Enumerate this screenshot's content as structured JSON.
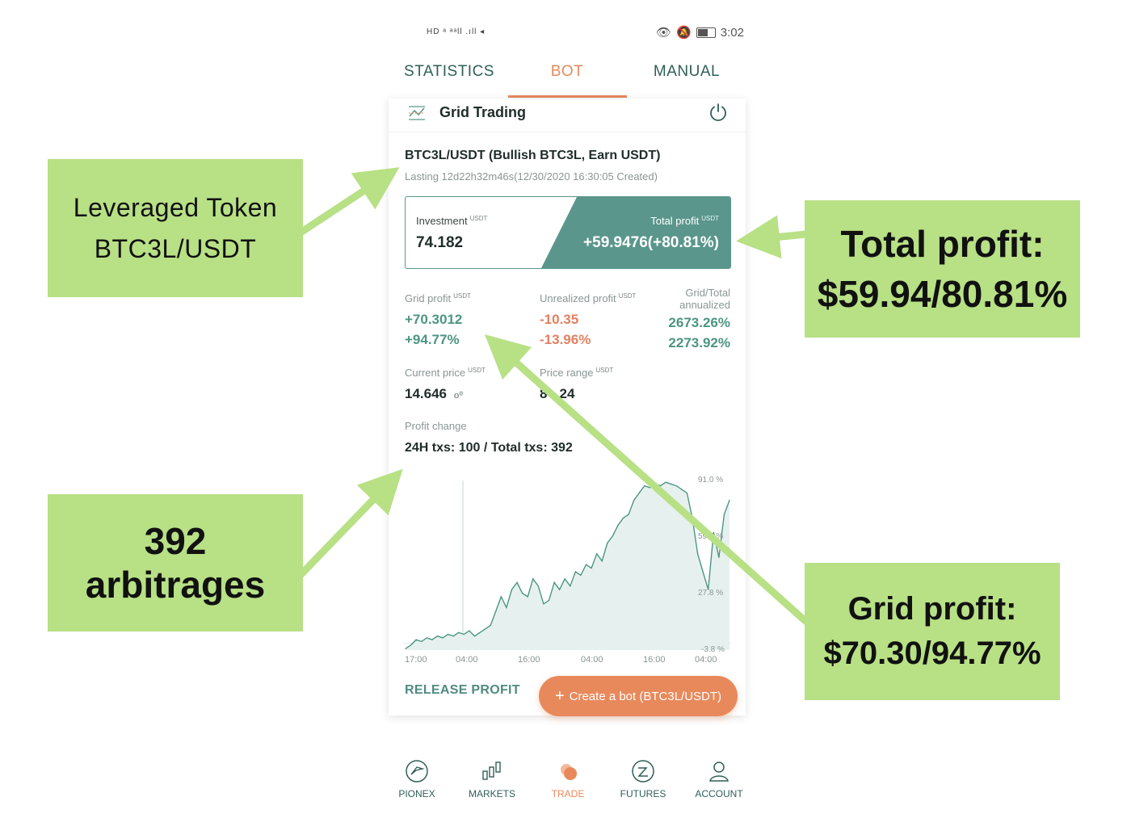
{
  "status_bar": {
    "left": "HD ᵃ ᵃᵃll .ıll ◂",
    "time": "3:02"
  },
  "tabs": [
    {
      "label": "STATISTICS"
    },
    {
      "label": "BOT"
    },
    {
      "label": "MANUAL"
    }
  ],
  "card": {
    "title": "Grid Trading",
    "pair": "BTC3L/USDT (Bullish BTC3L, Earn USDT)",
    "lasting": "Lasting 12d22h32m46s(12/30/2020 16:30:05 Created)",
    "investment_label": "Investment",
    "investment_value": "74.182",
    "unit": "USDT",
    "total_profit_label": "Total profit",
    "total_profit_value": "+59.9476(+80.81%)"
  },
  "stats": {
    "grid_profit_label": "Grid profit",
    "grid_profit_value": "+70.3012",
    "grid_profit_pct": "+94.77%",
    "unrealized_label": "Unrealized profit",
    "unrealized_value": "-10.35",
    "unrealized_pct": "-13.96%",
    "annualized_label_1": "Grid/Total",
    "annualized_label_2": "annualized",
    "annualized_grid": "2673.26%",
    "annualized_total": "2273.92%",
    "current_price_label": "Current price",
    "current_price_value": "14.646",
    "price_range_label": "Price range",
    "price_range_value": "8 - 24",
    "profit_change_label": "Profit change",
    "txs": "24H txs: 100 / Total txs: 392"
  },
  "chart_data": {
    "type": "line",
    "x_ticks": [
      "17:00",
      "04:00",
      "16:00",
      "04:00",
      "16:00",
      "04:00"
    ],
    "y_ticks": [
      "91.0 %",
      "59.4 %",
      "27.8 %",
      "-3.8 %"
    ],
    "ylim": [
      -3.8,
      91.0
    ],
    "values": [
      -3,
      -1,
      2,
      1,
      3,
      2,
      4,
      3,
      5,
      4,
      6,
      5,
      7,
      4,
      6,
      8,
      10,
      18,
      26,
      20,
      30,
      34,
      28,
      26,
      36,
      32,
      22,
      24,
      34,
      30,
      36,
      32,
      40,
      38,
      44,
      42,
      50,
      46,
      56,
      60,
      66,
      70,
      72,
      80,
      84,
      88,
      87,
      89,
      88,
      90,
      89,
      88,
      86,
      84,
      70,
      50,
      40,
      30,
      62,
      48,
      72,
      80
    ],
    "line_color": "#4c9583",
    "fill_color": "#e6f1ef"
  },
  "actions": {
    "release_profit": "RELEASE PROFIT",
    "create_bot": "Create a bot (BTC3L/USDT)"
  },
  "nav": [
    {
      "label": "PIONEX",
      "icon": "pionex-icon"
    },
    {
      "label": "MARKETS",
      "icon": "markets-icon"
    },
    {
      "label": "TRADE",
      "icon": "trade-icon"
    },
    {
      "label": "FUTURES",
      "icon": "futures-icon"
    },
    {
      "label": "ACCOUNT",
      "icon": "account-icon"
    }
  ],
  "annotations": {
    "leveraged_1": "Leveraged Token",
    "leveraged_2": "BTC3L/USDT",
    "total_profit_1": "Total profit:",
    "total_profit_2": "$59.94/80.81%",
    "arbitrages_1": "392",
    "arbitrages_2": "arbitrages",
    "grid_profit_1": "Grid profit:",
    "grid_profit_2": "$70.30/94.77%"
  },
  "colors": {
    "accent": "#e8895c",
    "teal": "#5a968b",
    "callout": "#b8e085",
    "arrow": "#b8e085"
  }
}
